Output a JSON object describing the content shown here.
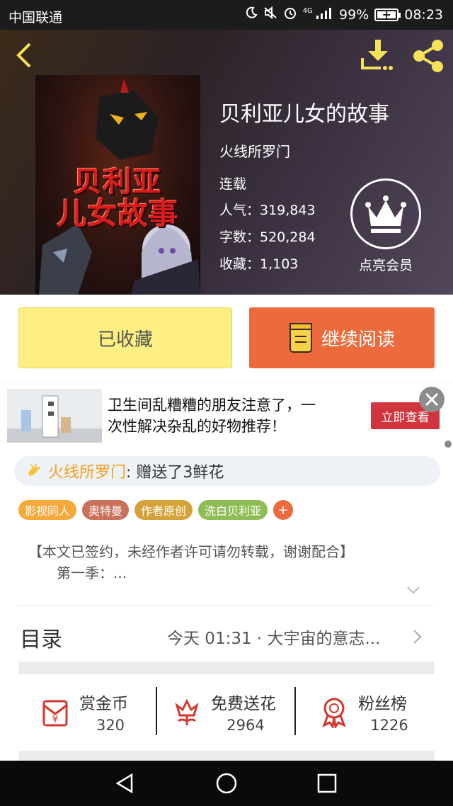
{
  "status_bar": {
    "carrier": "中国联通",
    "network": "4G",
    "battery": "99%",
    "battery_level": 0.99,
    "time": "08:23"
  },
  "header": {
    "icons": [
      "back-icon",
      "download-icon",
      "share-icon"
    ]
  },
  "book": {
    "cover_title_line1": "贝利亚",
    "cover_title_line2": "儿女故事",
    "title": "贝利亚儿女的故事",
    "author": "火线所罗门",
    "status": "连载",
    "stats": [
      {
        "label": "人气：319,843"
      },
      {
        "label": "字数：520,284"
      },
      {
        "label": "收藏：1,103"
      }
    ],
    "vip_label": "点亮会员"
  },
  "actions": {
    "collected_label": "已收藏",
    "continue_label": "继续阅读"
  },
  "ad": {
    "text_line1": "卫生间乱糟糟的朋友注意了，一",
    "text_line2": "次性解决杂乱的好物推荐！",
    "cta": "立即查看"
  },
  "flower": {
    "user": "火线所罗门",
    "message": ": 赠送了3鲜花"
  },
  "tags": [
    {
      "label": "影视同人",
      "color": "#f4a93a"
    },
    {
      "label": "奥特曼",
      "color": "#c9715a"
    },
    {
      "label": "作者原创",
      "color": "#d4a238"
    },
    {
      "label": "洗白贝利亚",
      "color": "#8fbd55"
    }
  ],
  "tag_add": "+",
  "synopsis": {
    "line1": "【本文已签约，未经作者许可请勿转载，谢谢配合】",
    "line2": "第一季：..."
  },
  "toc": {
    "label": "目录",
    "latest": "今天 01:31 · 大宇宙的意志..."
  },
  "bottom_stats": [
    {
      "name": "赏金币",
      "value": "320",
      "icon": "reward-coin-icon"
    },
    {
      "name": "免费送花",
      "value": "2964",
      "icon": "flower-icon"
    },
    {
      "name": "粉丝榜",
      "value": "1226",
      "icon": "medal-icon"
    }
  ],
  "colors": {
    "accent_orange": "#ec6a3c",
    "collected_yellow": "#fdef82",
    "gold": "#f0a21d",
    "icon_red": "#d4372f"
  }
}
